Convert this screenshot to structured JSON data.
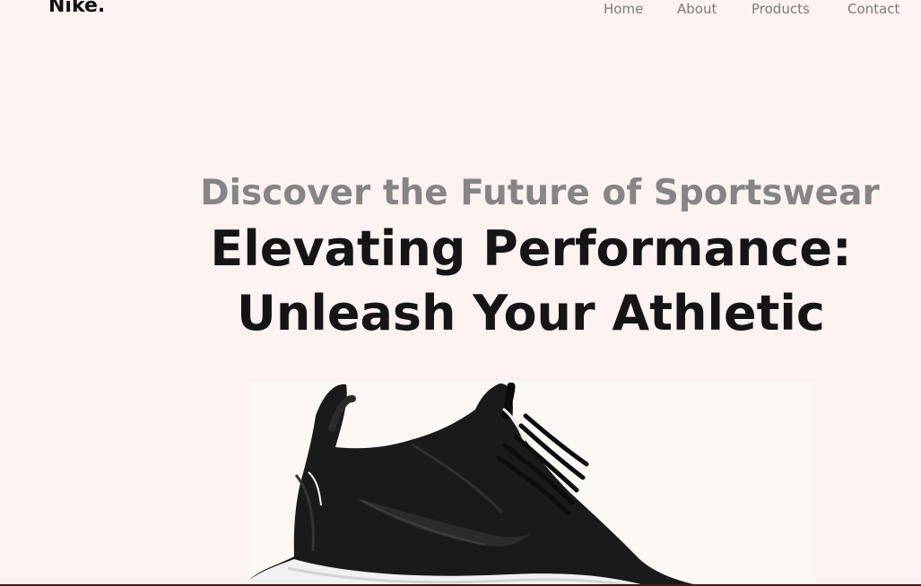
{
  "brand": {
    "name": "Nike."
  },
  "nav": {
    "items": [
      {
        "label": "Home"
      },
      {
        "label": "About"
      },
      {
        "label": "Products"
      },
      {
        "label": "Contact"
      }
    ]
  },
  "hero": {
    "eyebrow": "Discover the Future of Sportswear",
    "headline_line1": "Elevating Performance:",
    "headline_line2": "Unleash Your Athletic",
    "image": {
      "icon": "sneaker-image",
      "alt": ""
    }
  },
  "colors": {
    "background": "#fcf2f0",
    "brand_text": "#111111",
    "nav_text": "#7a7a7a",
    "eyebrow_text": "#858585",
    "headline_text": "#151515",
    "shoe_body": "#1b1b1b",
    "shoe_sole": "#f1f1f1"
  }
}
